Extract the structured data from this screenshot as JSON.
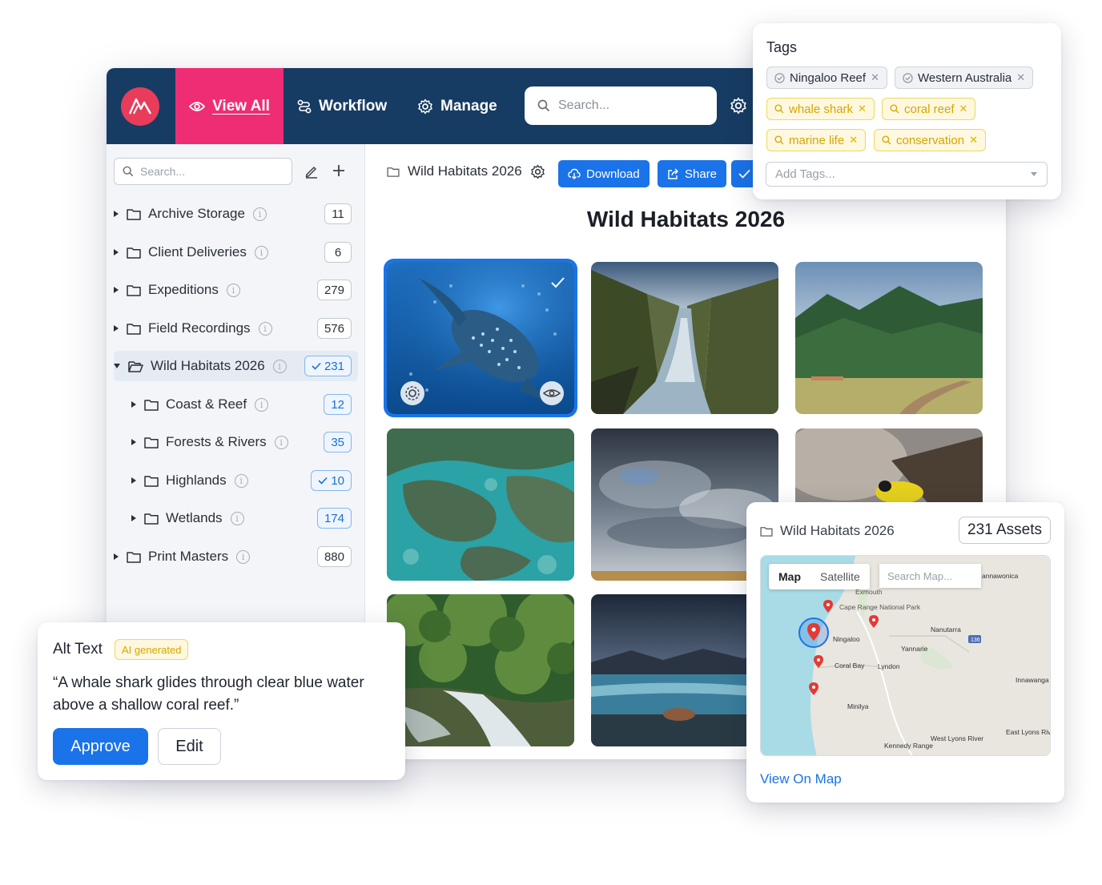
{
  "colors": {
    "nav": "#173c63",
    "nav_active": "#ef2d74",
    "accent": "#1a73e8",
    "logo": "#e83c5a",
    "tag_yellow": "#d6a600"
  },
  "nav": {
    "view_all": "View All",
    "workflow": "Workflow",
    "manage": "Manage",
    "search_placeholder": "Search..."
  },
  "sidebar": {
    "search_placeholder": "Search...",
    "items": [
      {
        "label": "Archive Storage",
        "count": "11"
      },
      {
        "label": "Client Deliveries",
        "count": "6"
      },
      {
        "label": "Expeditions",
        "count": "279"
      },
      {
        "label": "Field Recordings",
        "count": "576"
      },
      {
        "label": "Wild Habitats 2026",
        "count": "231",
        "selected": true
      },
      {
        "label": "Coast & Reef",
        "count": "12"
      },
      {
        "label": "Forests & Rivers",
        "count": "35"
      },
      {
        "label": "Highlands",
        "count": "10",
        "selected": true
      },
      {
        "label": "Wetlands",
        "count": "174"
      },
      {
        "label": "Print Masters",
        "count": "880"
      }
    ]
  },
  "content": {
    "breadcrumb": "Wild Habitats 2026",
    "download_label": "Download",
    "share_label": "Share",
    "title": "Wild Habitats 2026"
  },
  "tags_card": {
    "title": "Tags",
    "tags": [
      "Ningaloo Reef",
      "Western Australia",
      "whale shark",
      "coral reef",
      "marine life",
      "conservation"
    ],
    "add_placeholder": "Add Tags..."
  },
  "alt_card": {
    "title": "Alt Text",
    "badge": "AI generated",
    "text": "“A whale shark glides through clear blue water above a shallow coral reef.”",
    "approve_label": "Approve",
    "edit_label": "Edit"
  },
  "map_card": {
    "folder": "Wild Habitats 2026",
    "assets": "231 Assets",
    "tab_map": "Map",
    "tab_satellite": "Satellite",
    "search_placeholder": "Search Map...",
    "places": [
      "Exmouth",
      "Cape Range National Park",
      "Ningaloo",
      "Yannarie",
      "Nanutarra",
      "Coral Bay",
      "Lyndon",
      "Minilya",
      "Kennedy Range",
      "West Lyons River",
      "East Lyons River",
      "Innawanga",
      "annawonica"
    ],
    "road_number": "136",
    "view_link": "View On Map"
  }
}
